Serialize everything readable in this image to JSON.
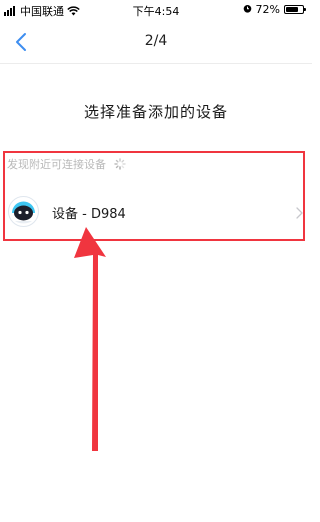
{
  "status_bar": {
    "carrier": "中国联通",
    "time": "下午4:54",
    "battery_percent": "72%",
    "battery_level": 0.72,
    "icons": [
      "signal-icon",
      "wifi-icon",
      "alarm-icon",
      "battery-icon"
    ]
  },
  "nav": {
    "back_icon": "chevron-left-icon",
    "title": "2/4"
  },
  "page": {
    "heading": "选择准备添加的设备"
  },
  "device_section": {
    "label": "发现附近可连接设备",
    "loading_icon": "loading-spinner-icon",
    "devices": [
      {
        "name": "设备 - D984",
        "icon": "robot-avatar-icon",
        "chevron_icon": "chevron-right-icon"
      }
    ]
  },
  "annotation": {
    "color": "#f0353f",
    "shapes": [
      "highlight-box",
      "arrow-up"
    ]
  },
  "colors": {
    "accent": "#3d8ef0",
    "muted_text": "#b9b9b9",
    "annotation_red": "#f0353f"
  }
}
